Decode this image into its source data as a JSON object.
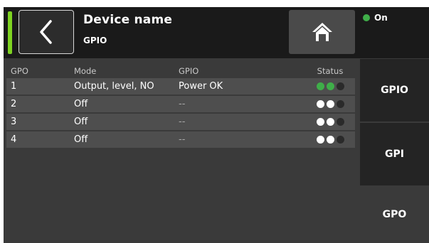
{
  "header": {
    "device_name": "Device name",
    "subtitle": "GPIO",
    "status_label": "On",
    "accent_color": "#7ed321",
    "status_color": "#3fae49"
  },
  "table": {
    "columns": [
      "GPO",
      "Mode",
      "GPIO",
      "Status"
    ],
    "rows": [
      {
        "gpo": "1",
        "mode": "Output, level, NO",
        "gpio": "Power OK",
        "leds": [
          "green",
          "green",
          "dark"
        ]
      },
      {
        "gpo": "2",
        "mode": "Off",
        "gpio": "--",
        "leds": [
          "white",
          "white",
          "dark"
        ]
      },
      {
        "gpo": "3",
        "mode": "Off",
        "gpio": "--",
        "leds": [
          "white",
          "white",
          "dark"
        ]
      },
      {
        "gpo": "4",
        "mode": "Off",
        "gpio": "--",
        "leds": [
          "white",
          "white",
          "dark"
        ]
      }
    ]
  },
  "tabs": {
    "gpio": "GPIO",
    "gpi": "GPI",
    "gpo": "GPO",
    "active": "gpo"
  },
  "icons": {
    "back": "chevron-left-icon",
    "home": "home-icon"
  }
}
